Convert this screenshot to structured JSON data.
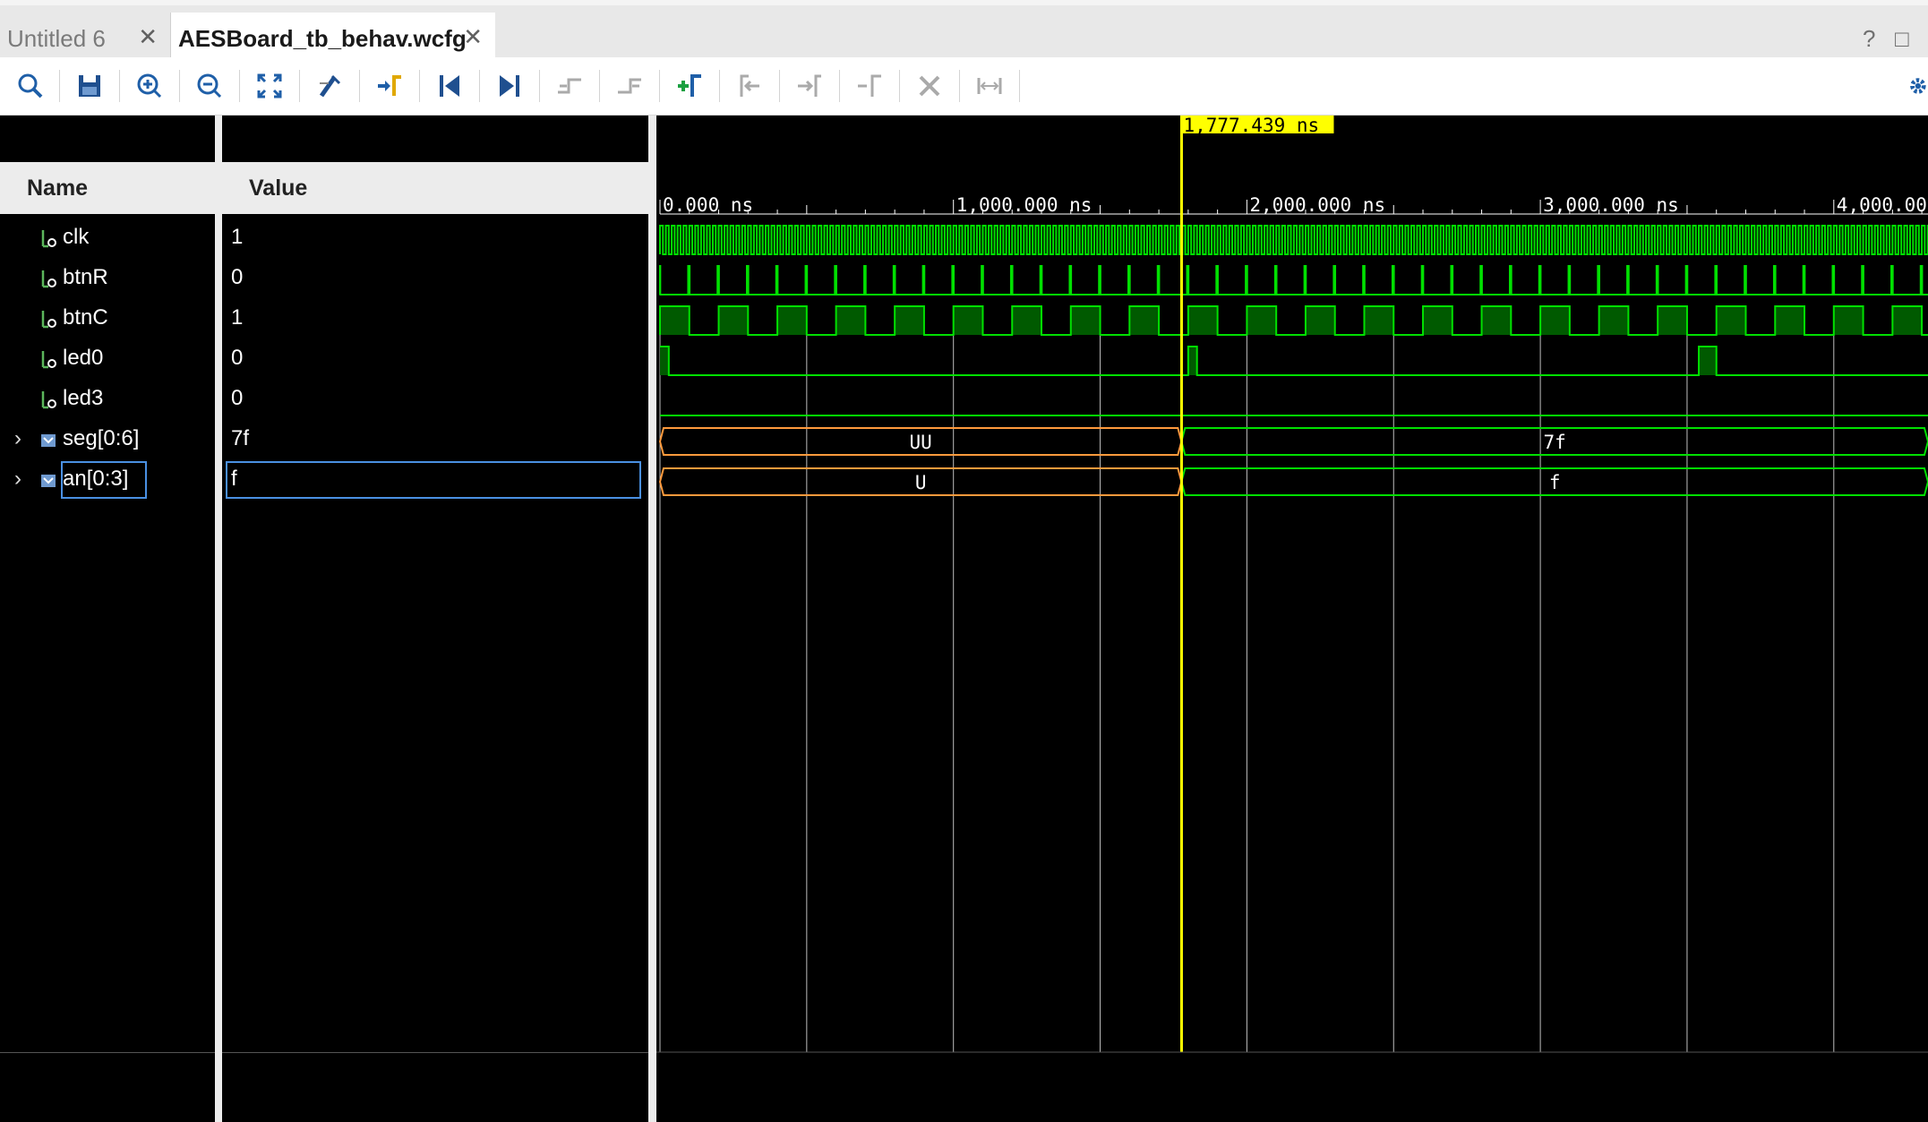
{
  "tabs": [
    {
      "label": "Untitled 6",
      "active": false
    },
    {
      "label": "AESBoard_tb_behav.wcfg",
      "active": true
    }
  ],
  "window_controls": {
    "help": "?",
    "maximize": "□"
  },
  "toolbar": {
    "buttons": [
      "search-icon",
      "save-icon",
      "zoom-in-icon",
      "zoom-out-icon",
      "zoom-fit-icon",
      "snap-icon",
      "go-to-cursor-icon",
      "go-to-time-zero-icon",
      "go-to-last-time-icon",
      "previous-transition-icon",
      "next-transition-icon",
      "add-marker-icon",
      "previous-marker-icon",
      "next-marker-icon",
      "swap-cursors-icon",
      "delete-all-markers-icon",
      "fix-range-icon",
      "settings-icon"
    ]
  },
  "columns": {
    "name": "Name",
    "value": "Value"
  },
  "signals": [
    {
      "name": "clk",
      "value": "1",
      "kind": "bit",
      "expandable": false
    },
    {
      "name": "btnR",
      "value": "0",
      "kind": "bit",
      "expandable": false
    },
    {
      "name": "btnC",
      "value": "1",
      "kind": "bit",
      "expandable": false
    },
    {
      "name": "led0",
      "value": "0",
      "kind": "bit",
      "expandable": false
    },
    {
      "name": "led3",
      "value": "0",
      "kind": "bit",
      "expandable": false
    },
    {
      "name": "seg[0:6]",
      "value": "7f",
      "kind": "bus",
      "expandable": true
    },
    {
      "name": "an[0:3]",
      "value": "f",
      "kind": "bus",
      "expandable": true,
      "selected": true
    }
  ],
  "ruler": {
    "labels": [
      "0.000 ns",
      "1,000.000 ns",
      "2,000.000 ns",
      "3,000.000 ns",
      "4,000.00"
    ],
    "start_ns": 0,
    "major_step_ns": 1000,
    "minor_step_ns": 500
  },
  "cursor": {
    "label": "1,777.439 ns",
    "time_ns": 1777.439
  },
  "waveforms": {
    "seg": [
      {
        "from_ns": 0,
        "to_ns": 1777,
        "text": "UU",
        "state": "unknown"
      },
      {
        "from_ns": 1777,
        "to_ns": 4400,
        "text": "7f",
        "state": "valid"
      }
    ],
    "an": [
      {
        "from_ns": 0,
        "to_ns": 1777,
        "text": "U",
        "state": "unknown"
      },
      {
        "from_ns": 1777,
        "to_ns": 4400,
        "text": "f",
        "state": "valid"
      }
    ]
  },
  "colors": {
    "wave": "#00e000",
    "wave_fill": "#005a00",
    "unknown": "#ff9a3c",
    "cursor": "#ffff00",
    "grid": "#bfbfbf",
    "selection": "#4a90e2"
  }
}
